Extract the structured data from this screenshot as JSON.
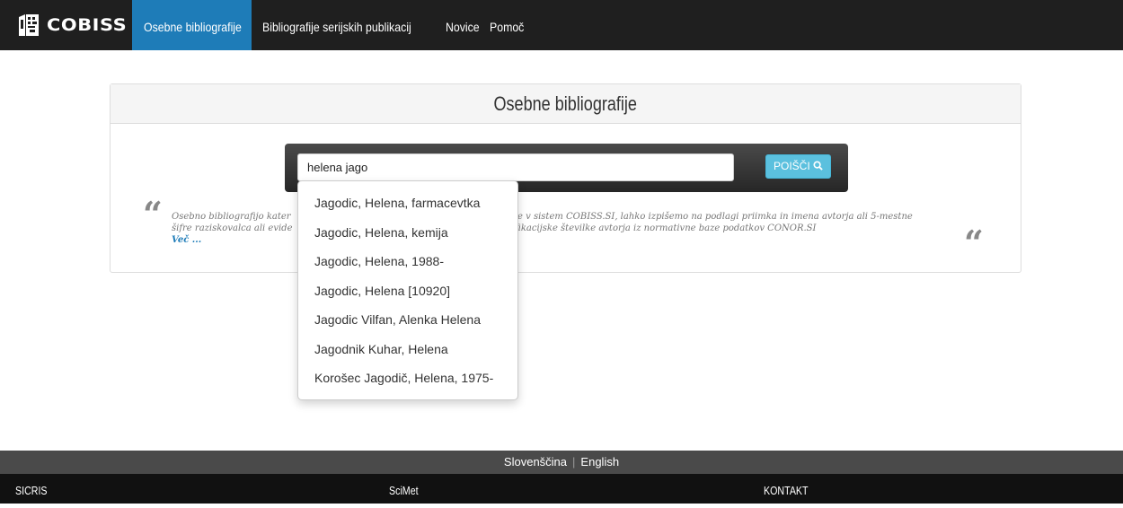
{
  "brand": {
    "name": "COBISS"
  },
  "nav": {
    "items": [
      "Osebne bibliografije",
      "Bibliografije serijskih publikacij",
      "Novice",
      "Pomoč"
    ]
  },
  "panel": {
    "title": "Osebne bibliografije"
  },
  "search": {
    "value": "helena jago",
    "button_label": "POIŠČI"
  },
  "description": {
    "line1_left": "Osebno bibliografijo kater",
    "line1_right": "note v sistem COBISS.SI, lahko izpišemo na podlagi priimka in imena avtorja ali 5-mestne",
    "line2_left": "šifre raziskovalca ali evide",
    "line2_right": "ntifikacijske številke avtorja iz normativne baze podatkov CONOR.SI",
    "more_link": "Več ..."
  },
  "autocomplete": {
    "items": [
      "Jagodic, Helena, farmacevtka",
      "Jagodic, Helena, kemija",
      "Jagodic, Helena, 1988-",
      "Jagodic, Helena [10920]",
      "Jagodic Vilfan, Alenka Helena",
      "Jagodnik Kuhar, Helena",
      "Korošec Jagodič, Helena, 1975-"
    ]
  },
  "footer": {
    "lang_sl": "Slovenščina",
    "lang_sep": "|",
    "lang_en": "English",
    "links": [
      "SICRIS",
      "SciMet",
      "KONTAKT"
    ]
  },
  "colors": {
    "nav_bg": "#1f1f1f",
    "nav_active": "#1e7cb8",
    "button": "#5bc0de",
    "link": "#1e7cb8"
  },
  "icons": [
    "cobiss-logo-icon",
    "search-icon",
    "quote-open-icon",
    "quote-close-icon"
  ]
}
